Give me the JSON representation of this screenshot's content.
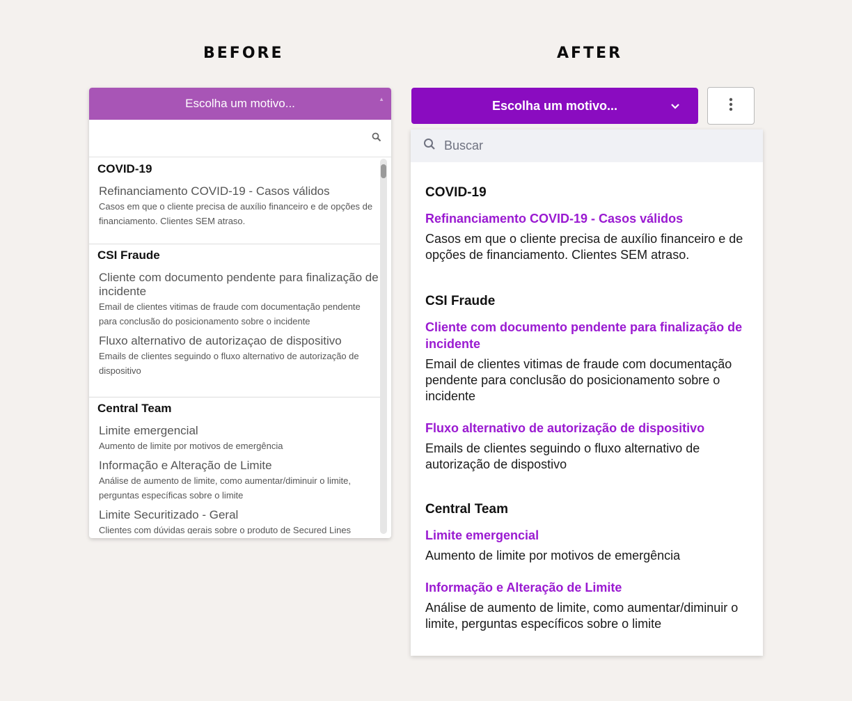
{
  "headings": {
    "before": "BEFORE",
    "after": "AFTER"
  },
  "before": {
    "button_label": "Escolha um motivo...",
    "groups": [
      {
        "title": "COVID-19",
        "items": [
          {
            "title": "Refinanciamento COVID-19 - Casos válidos",
            "desc": "Casos em que o cliente precisa de auxílio financeiro e de opções de financiamento. Clientes SEM atraso."
          }
        ]
      },
      {
        "title": "CSI Fraude",
        "items": [
          {
            "title": "Cliente com documento pendente para finalização de incidente",
            "desc": "Email de clientes vitimas de fraude com documentação pendente para conclusão do posicionamento sobre o incidente"
          },
          {
            "title": "Fluxo alternativo de autorizaçao de dispositivo",
            "desc": "Emails de clientes seguindo o fluxo alternativo de autorização de dispositivo"
          }
        ]
      },
      {
        "title": "Central Team",
        "items": [
          {
            "title": "Limite emergencial",
            "desc": "Aumento de limite por motivos de emergência"
          },
          {
            "title": "Informação e Alteração de Limite",
            "desc": "Análise de aumento de limite, como aumentar/diminuir o limite, perguntas específicas sobre o limite"
          },
          {
            "title": "Limite Securitizado - Geral",
            "desc": "Clientes com dúvidas gerais sobre o produto de Secured Lines"
          }
        ]
      }
    ]
  },
  "after": {
    "button_label": "Escolha um motivo...",
    "search_placeholder": "Buscar",
    "groups": [
      {
        "title": "COVID-19",
        "items": [
          {
            "title": "Refinanciamento COVID-19 - Casos válidos",
            "desc": "Casos em que o cliente precisa de auxílio financeiro e de opções de financiamento. Clientes SEM atraso."
          }
        ]
      },
      {
        "title": "CSI Fraude",
        "items": [
          {
            "title": "Cliente com documento pendente para finalização de incidente",
            "desc": "Email de clientes vitimas de fraude com documentação pendente para conclusão do posicionamento sobre o incidente"
          },
          {
            "title": "Fluxo alternativo de autorização de dispositivo",
            "desc": "Emails de clientes seguindo o fluxo alternativo de autorização de dispostivo"
          }
        ]
      },
      {
        "title": "Central Team",
        "items": [
          {
            "title": "Limite emergencial",
            "desc": "Aumento de limite por motivos de emergência"
          },
          {
            "title": "Informação e Alteração de Limite",
            "desc": "Análise de aumento de limite, como aumentar/diminuir o limite, perguntas específicos sobre o limite"
          }
        ]
      }
    ]
  },
  "colors": {
    "before_button": "#a855b6",
    "after_button": "#8a0cc0",
    "after_item_title": "#9a1ad1",
    "background": "#f4f1ee"
  }
}
